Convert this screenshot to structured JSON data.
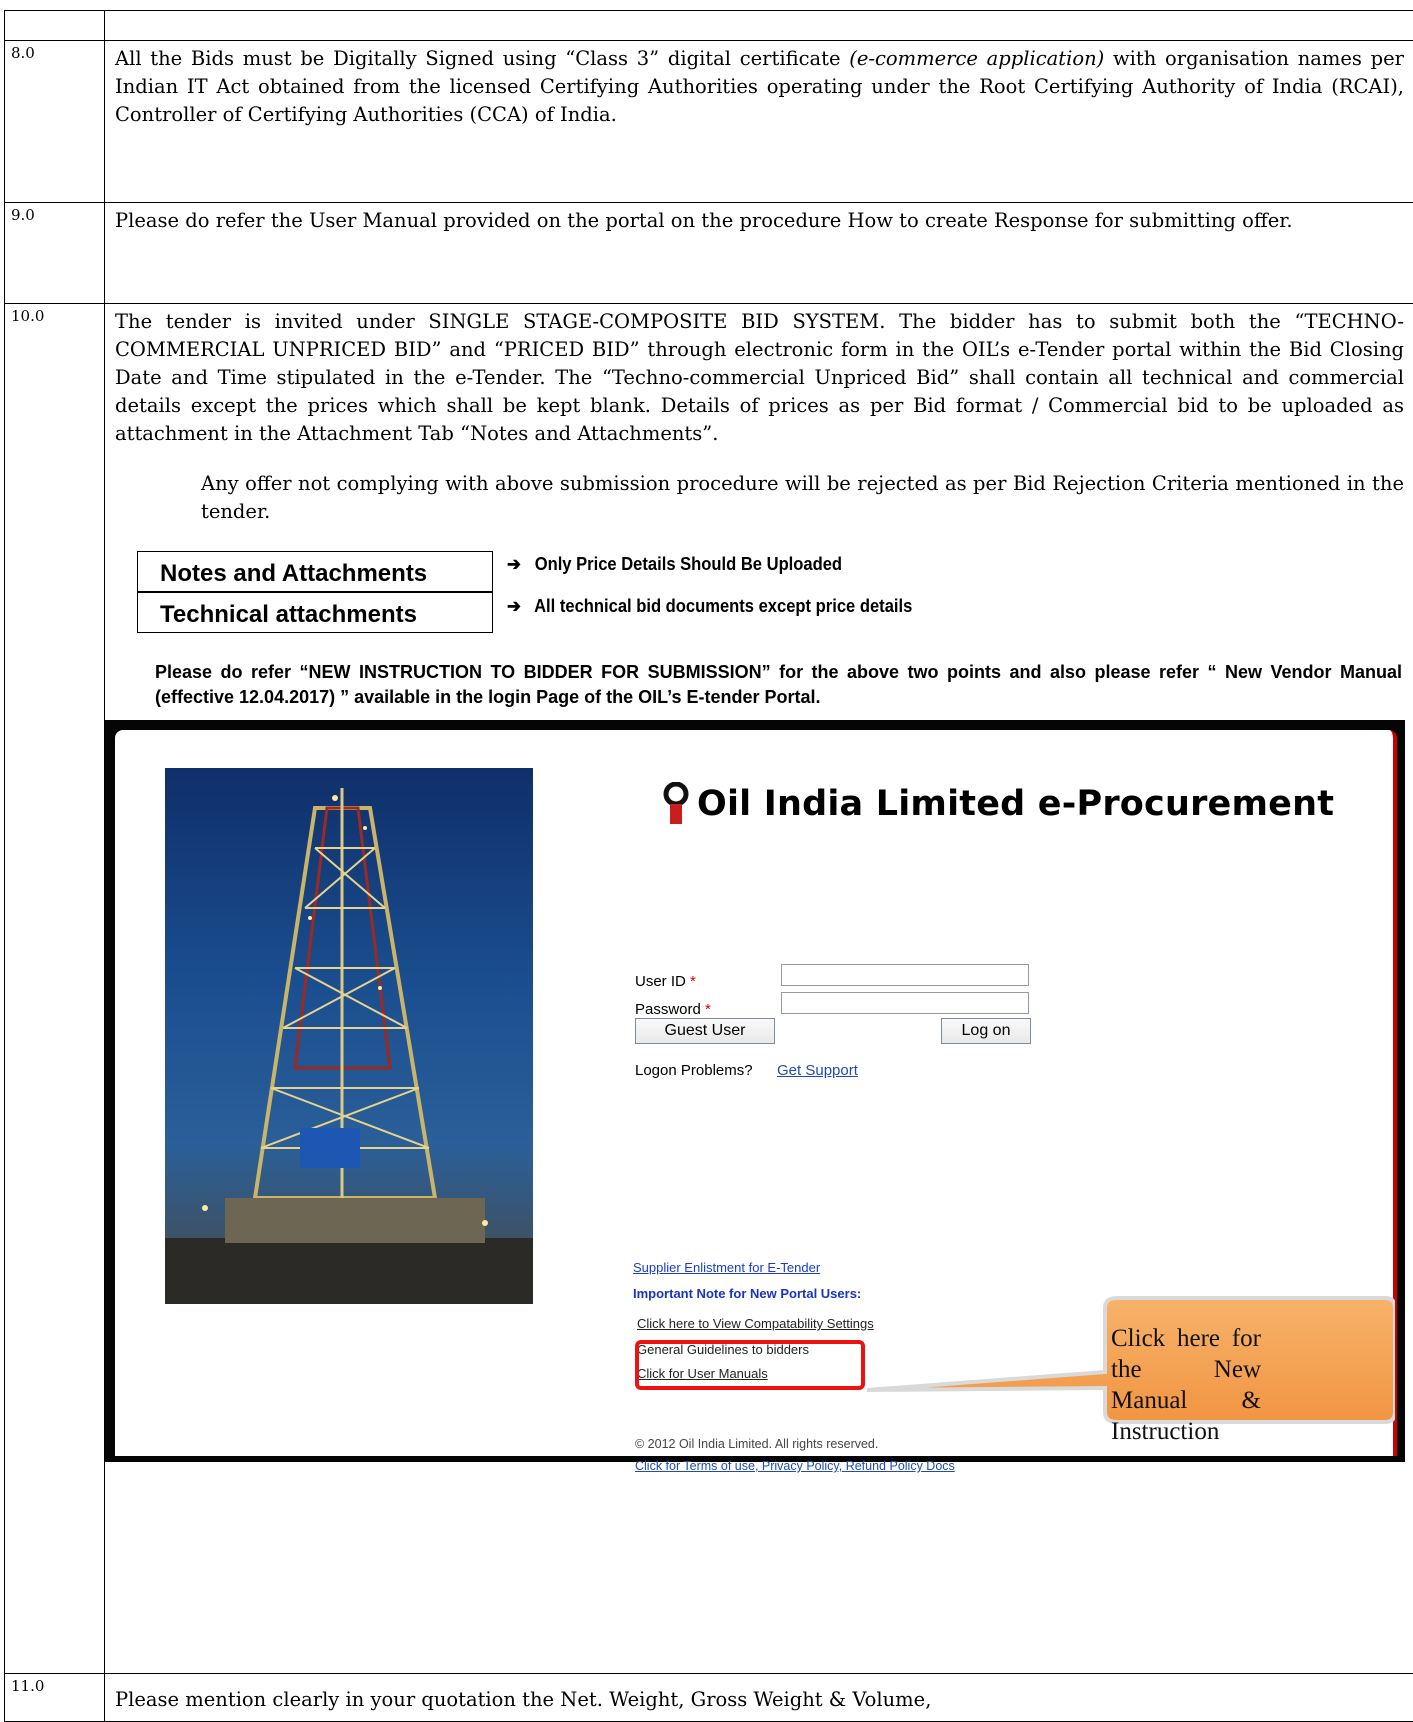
{
  "items": [
    {
      "number": "8.0",
      "text_a": "All the Bids must be Digitally Signed using “Class 3” digital certificate ",
      "text_italic": "(e-commerce application)",
      "text_b": " with organisation names per Indian IT Act obtained from the licensed Certifying Authorities operating under the Root Certifying Authority of India (RCAI), Controller of Certifying Authorities (CCA) of India."
    },
    {
      "number": "9.0",
      "text": "Please do refer the User Manual provided on the portal on the procedure How to create Response for submitting offer."
    },
    {
      "number": "10.0",
      "text": "The tender is invited under SINGLE STAGE-COMPOSITE BID SYSTEM. The bidder has to submit both the “TECHNO-COMMERCIAL UNPRICED BID” and “PRICED BID” through electronic form in the OIL’s e-Tender portal within the Bid Closing Date and Time stipulated in the e-Tender. The “Techno-commercial Unpriced Bid” shall contain all technical and commercial details except the prices which shall be kept blank. Details of prices as per Bid format / Commercial bid to be uploaded as attachment in the Attachment Tab “Notes and Attachments”.",
      "indent_text": "Any offer not complying with above submission procedure will be rejected as per Bid Rejection Criteria mentioned in the tender."
    },
    {
      "number": "11.0",
      "text": "Please mention clearly in your quotation the Net. Weight, Gross Weight & Volume,"
    }
  ],
  "attachments": [
    {
      "box": "Notes and Attachments",
      "note": "Only Price Details Should Be Uploaded"
    },
    {
      "box": "Technical attachments",
      "note": "All technical bid documents except price details"
    }
  ],
  "arrow_glyph": "➔",
  "please_note": "Please do refer “NEW INSTRUCTION TO BIDDER FOR SUBMISSION” for the above two points and also please refer “ New Vendor  Manual (effective 12.04.2017) ” available in the login Page of the OIL’s E-tender Portal.",
  "portal": {
    "title": "Oil India Limited e-Procurement",
    "user_id_label": "User ID",
    "password_label": "Password",
    "required_mark": "*",
    "guest_button": "Guest User",
    "logon_button": "Log on",
    "logon_problems": "Logon Problems?",
    "get_support": "Get Support",
    "supplier_link": "Supplier Enlistment for E-Tender",
    "important_note": "Important Note for New Portal Users:",
    "compat_link": "Click here to View Compatability Settings",
    "guidelines": "General Guidelines to bidders",
    "manuals_link": "Click for User Manuals",
    "copyright": "© 2012 Oil India Limited. All rights reserved.",
    "terms_link": "Click for Terms of use, Privacy Policy, Refund Policy Docs",
    "callout": "Click here for the New Manual & Instruction",
    "colors": {
      "highlight": "#ee1111",
      "callout_fill": "#f4a04e",
      "link": "#1a3bd0"
    }
  }
}
